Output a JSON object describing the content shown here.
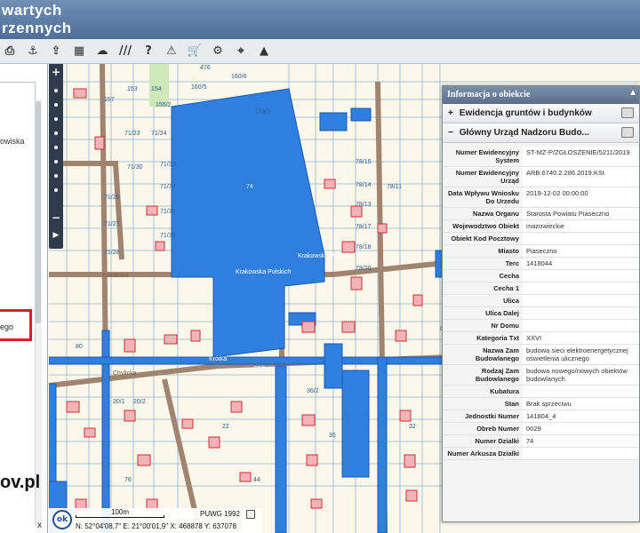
{
  "header": {
    "line1": "wartych",
    "line2": "rzennych"
  },
  "toolbar": {
    "icons": [
      "print-icon",
      "anchor-icon",
      "export-icon",
      "layers-icon",
      "comment-icon",
      "hatch-icon",
      "help-icon",
      "warning-icon",
      "cart-icon",
      "settings-icon",
      "location-icon",
      "mountain-icon"
    ]
  },
  "left_panel": {
    "snippet1": "owiska",
    "snippet2": "ego",
    "brand": "ov.pl",
    "close": "x"
  },
  "map": {
    "street_labels": [
      "Krakowska Polskich",
      "Krakowska Polskich",
      "Krótka",
      "Kwiatowa",
      "Chylicka",
      "Orkana"
    ],
    "parcel_labels": [
      "476",
      "160/6",
      "160/5",
      "153",
      "154",
      "157",
      "155/2",
      "159/2",
      "71/28",
      "71/23",
      "71/24",
      "71/30",
      "71/27",
      "71/26",
      "71/33",
      "71/34",
      "71/35",
      "71/36",
      "78/15",
      "78/14",
      "78/13",
      "78/17",
      "78/18",
      "78/20",
      "78/11",
      "71/28",
      "74",
      "80",
      "77/2",
      "20/1",
      "20/2",
      "22",
      "44",
      "76",
      "36/2",
      "35",
      "32"
    ],
    "zoom_in": "+",
    "zoom_out": "−",
    "play": "▶",
    "ok": "ok",
    "scale": "100m",
    "crs": "PUWG 1992",
    "coords": "N: 52°04'08,7\"  E: 21°00'01,9\"  X: 468878  Y: 637078"
  },
  "info_panel": {
    "title": "Informacja o obiekcie",
    "section1": {
      "sign": "+",
      "label": "Ewidencja gruntów i budynków"
    },
    "section2": {
      "sign": "−",
      "label": "Główny Urząd Nadzoru Budo..."
    },
    "fields": [
      {
        "k": "Numer Ewidencyjny System",
        "v": "ST-MZ-P/ZGŁOSZENIE/5211/2019"
      },
      {
        "k": "Numer Ewidencyjny Urząd",
        "v": "ARB.6740.2.286.2019.KSt"
      },
      {
        "k": "Data Wpływu Wniosku Do Urzedu",
        "v": "2019-12-02 00:00:00"
      },
      {
        "k": "Nazwa Organu",
        "v": "Starosta Powiatu Piaseczno"
      },
      {
        "k": "Wojewodztwo Obiekt",
        "v": "mazowieckie"
      },
      {
        "k": "Obiekt Kod Pocztowy",
        "v": ""
      },
      {
        "k": "Miasto",
        "v": "Piaseczno"
      },
      {
        "k": "Terc",
        "v": "1418044"
      },
      {
        "k": "Cecha",
        "v": ""
      },
      {
        "k": "Cecha 1",
        "v": ""
      },
      {
        "k": "Ulica",
        "v": ""
      },
      {
        "k": "Ulica Dalej",
        "v": ""
      },
      {
        "k": "Nr Domu",
        "v": ""
      },
      {
        "k": "Kategoria Txt",
        "v": "XXVI"
      },
      {
        "k": "Nazwa Zam Budowlanego",
        "v": "budowa sieci elektroenergetycznej oświetlenia ulicznego"
      },
      {
        "k": "Rodzaj Zam Budowlanego",
        "v": "budowa nowego/nowych obiektów budowlanych"
      },
      {
        "k": "Kubatura",
        "v": ""
      },
      {
        "k": "Stan",
        "v": "Brak sprzeciwu"
      },
      {
        "k": "Jednostki Numer",
        "v": "141804_4"
      },
      {
        "k": "Obreb Numer",
        "v": "0029"
      },
      {
        "k": "Numer Dzialki",
        "v": "74"
      },
      {
        "k": "Numer Arkusza Dzialki",
        "v": ""
      }
    ]
  },
  "colors": {
    "parcel_blue": "#2f7fe0",
    "building_red": "#c8323a",
    "road_brown": "#a08470",
    "header_blue": "#5a7aa3"
  }
}
